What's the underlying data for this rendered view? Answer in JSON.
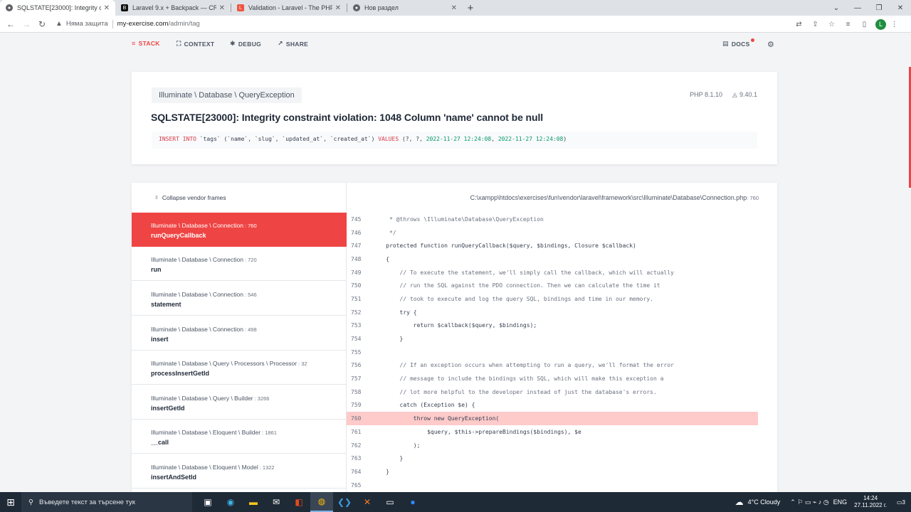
{
  "browser": {
    "tabs": [
      {
        "title": "SQLSTATE[23000]: Integrity constr",
        "active": true,
        "fav": "globe-icon"
      },
      {
        "title": "Laravel 9.x + Backpack — CRUD",
        "active": false,
        "fav": "backpack-icon"
      },
      {
        "title": "Validation - Laravel - The PHP Fr",
        "active": false,
        "fav": "laravel-icon"
      },
      {
        "title": "Нов раздел",
        "active": false,
        "fav": "globe-icon"
      }
    ],
    "new_tab": "+",
    "security": "Няма защита",
    "url_host": "my-exercise.com",
    "url_path": "/admin/tag",
    "profile_letter": "L"
  },
  "ignition_nav": {
    "stack": "STACK",
    "context": "CONTEXT",
    "debug": "DEBUG",
    "share": "SHARE",
    "docs": "DOCS"
  },
  "exception": {
    "class": "Illuminate \\ Database \\ QueryException",
    "php_version": "PHP 8.1.10",
    "laravel_version": "9.40.1",
    "message": "SQLSTATE[23000]: Integrity constraint violation: 1048 Column 'name' cannot be null",
    "sql_kw1": "INSERT INTO",
    "sql_mid": " `tags` (`name`, `slug`, `updated_at`, `created_at`) ",
    "sql_kw2": "VALUES",
    "sql_pre": " (?, ?, ",
    "sql_d1": "2022-11-27 12:24:08",
    "sql_comma": ", ",
    "sql_d2": "2022-11-27 12:24:08",
    "sql_end": ")"
  },
  "frames": {
    "collapse_label": "Collapse vendor frames",
    "items": [
      {
        "cls": "Illuminate \\ Database \\ Connection",
        "line": ": 760",
        "fn": "runQueryCallback"
      },
      {
        "cls": "Illuminate \\ Database \\ Connection",
        "line": ": 720",
        "fn": "run"
      },
      {
        "cls": "Illuminate \\ Database \\ Connection",
        "line": ": 546",
        "fn": "statement"
      },
      {
        "cls": "Illuminate \\ Database \\ Connection",
        "line": ": 498",
        "fn": "insert"
      },
      {
        "cls": "Illuminate \\ Database \\ Query \\ Processors \\ Processor",
        "line": ": 32",
        "fn": "processInsertGetId"
      },
      {
        "cls": "Illuminate \\ Database \\ Query \\ Builder",
        "line": ": 3266",
        "fn": "insertGetId"
      },
      {
        "cls": "Illuminate \\ Database \\ Eloquent \\ Builder",
        "line": ": 1861",
        "fn": "__call"
      },
      {
        "cls": "Illuminate \\ Database \\ Eloquent \\ Model",
        "line": ": 1322",
        "fn": "insertAndSetId"
      }
    ]
  },
  "code": {
    "file_path": "C:\\xampp\\htdocs\\exercises\\fun\\vendor\\laravel\\framework\\src\\Illuminate\\Database\\Connection.php",
    "file_line": ": 760",
    "lines": [
      {
        "n": "745",
        "t": "     * @throws \\Illuminate\\Database\\QueryException"
      },
      {
        "n": "746",
        "t": "     */"
      },
      {
        "n": "747",
        "t": "    protected function runQueryCallback($query, $bindings, Closure $callback)"
      },
      {
        "n": "748",
        "t": "    {"
      },
      {
        "n": "749",
        "t": "        // To execute the statement, we'll simply call the callback, which will actually"
      },
      {
        "n": "750",
        "t": "        // run the SQL against the PDO connection. Then we can calculate the time it"
      },
      {
        "n": "751",
        "t": "        // took to execute and log the query SQL, bindings and time in our memory."
      },
      {
        "n": "752",
        "t": "        try {"
      },
      {
        "n": "753",
        "t": "            return $callback($query, $bindings);"
      },
      {
        "n": "754",
        "t": "        }"
      },
      {
        "n": "755",
        "t": ""
      },
      {
        "n": "756",
        "t": "        // If an exception occurs when attempting to run a query, we'll format the error"
      },
      {
        "n": "757",
        "t": "        // message to include the bindings with SQL, which will make this exception a"
      },
      {
        "n": "758",
        "t": "        // lot more helpful to the developer instead of just the database's errors."
      },
      {
        "n": "759",
        "t": "        catch (Exception $e) {"
      },
      {
        "n": "760",
        "t": "            throw new QueryException("
      },
      {
        "n": "761",
        "t": "                $query, $this->prepareBindings($bindings), $e"
      },
      {
        "n": "762",
        "t": "            );"
      },
      {
        "n": "763",
        "t": "        }"
      },
      {
        "n": "764",
        "t": "    }"
      },
      {
        "n": "765",
        "t": ""
      }
    ],
    "highlight_line": "760"
  },
  "taskbar": {
    "search_placeholder": "Въведете текст за търсене тук",
    "weather": "4°C  Cloudy",
    "lang": "ENG",
    "time": "14:24",
    "date": "27.11.2022 г.",
    "notif_count": "3"
  },
  "colors": {
    "accent": "#ef4444",
    "highlight": "#fecaca"
  }
}
